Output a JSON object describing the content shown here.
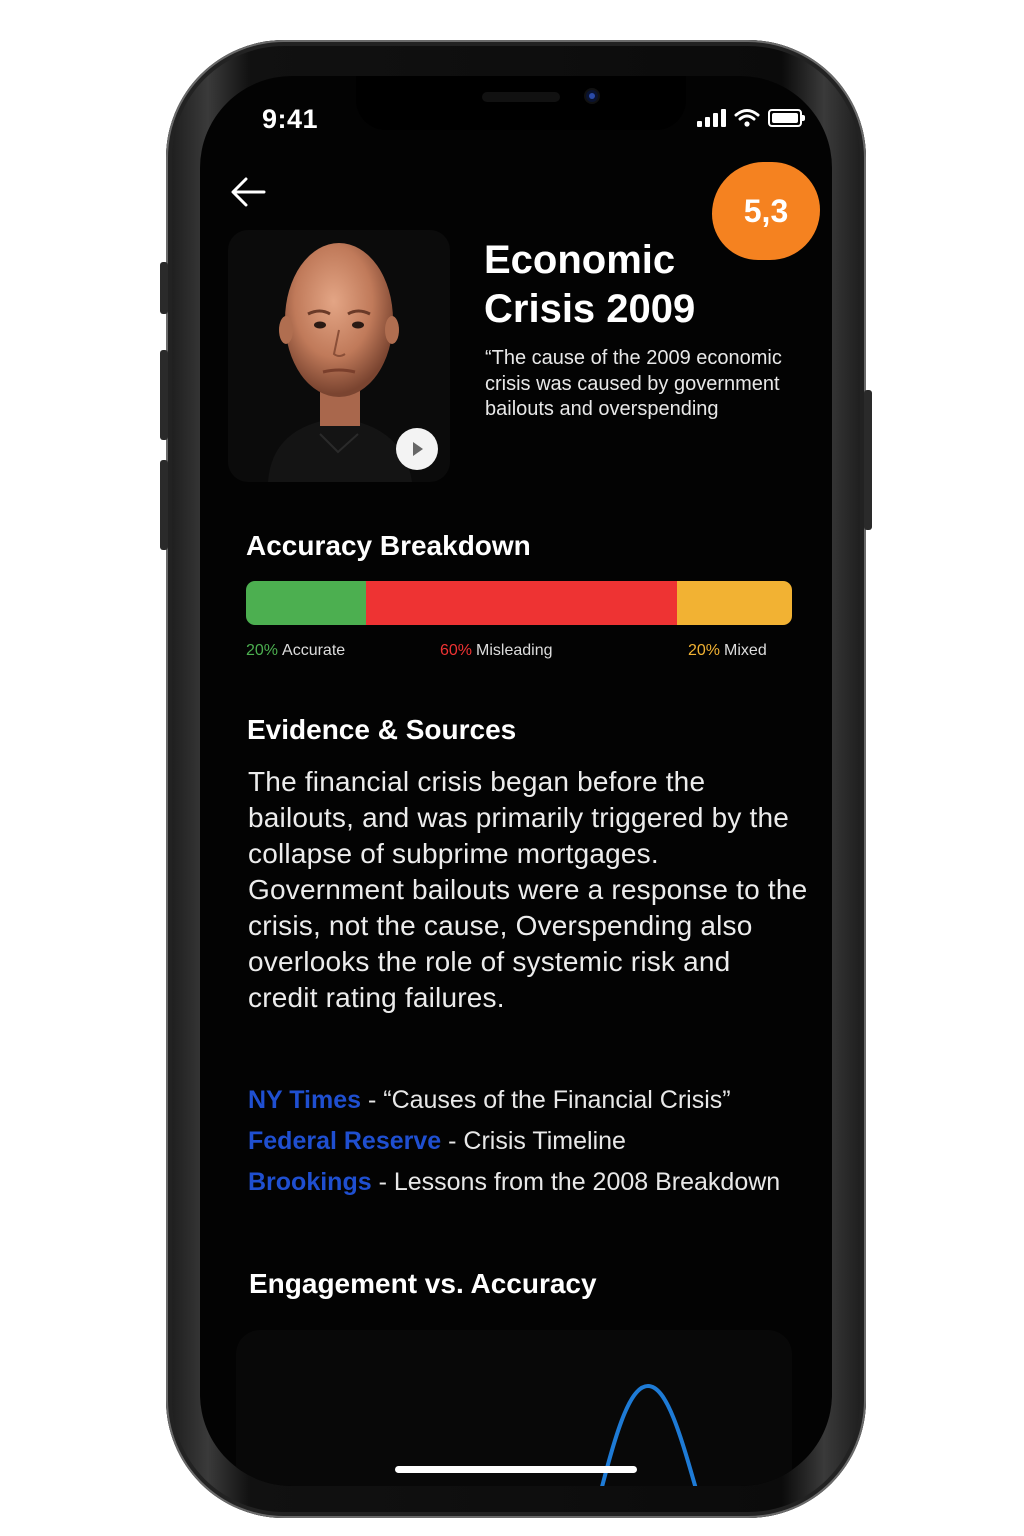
{
  "status_bar": {
    "time": "9:41"
  },
  "header": {
    "score": "5,3",
    "title": "Economic\nCrisis 2009",
    "quote": "“The cause of the 2009 economic crisis was caused by government bailouts and overspending"
  },
  "accuracy": {
    "heading": "Accuracy Breakdown",
    "segments": [
      {
        "key": "accurate",
        "fraction": 0.22,
        "color": "#4caf50",
        "pct": "20%",
        "label": "Accurate"
      },
      {
        "key": "misleading",
        "fraction": 0.57,
        "color": "#ee3333",
        "pct": "60%",
        "label": "Misleading"
      },
      {
        "key": "mixed",
        "fraction": 0.21,
        "color": "#f2b233",
        "pct": "20%",
        "label": "Mixed"
      }
    ]
  },
  "evidence": {
    "heading": "Evidence & Sources",
    "body": "The financial crisis began before the bailouts, and was primarily triggered by the collapse of subprime mortgages. Government bailouts were a response to the crisis, not the cause, Overspending also overlooks the role of systemic risk and credit rating failures.",
    "sources": [
      {
        "name": "NY Times",
        "desc": " - “Causes of the Financial Crisis”"
      },
      {
        "name": "Federal Reserve",
        "desc": " - Crisis Timeline"
      },
      {
        "name": "Brookings",
        "desc": " -  Lessons from the 2008 Breakdown"
      }
    ]
  },
  "engagement": {
    "heading": "Engagement vs. Accuracy",
    "line_color": "#1e7bd6"
  },
  "colors": {
    "accent": "#f58220",
    "link": "#1f4fd0",
    "background": "#030303"
  }
}
